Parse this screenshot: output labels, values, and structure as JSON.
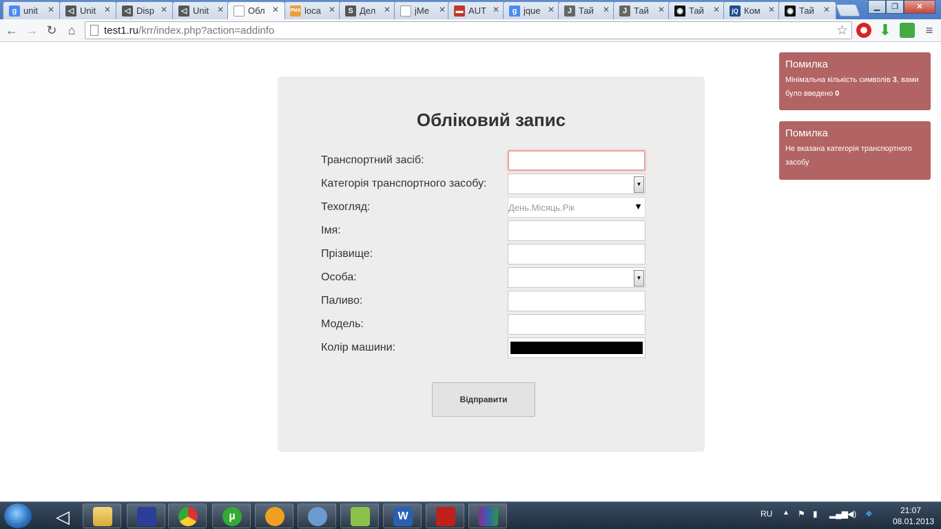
{
  "browser": {
    "tabs": [
      {
        "title": "unit",
        "fav": "g",
        "color": "#4a8af4"
      },
      {
        "title": "Unit",
        "fav": "◁",
        "color": "#555555"
      },
      {
        "title": "Disp",
        "fav": "◁",
        "color": "#555555"
      },
      {
        "title": "Unit",
        "fav": "◁",
        "color": "#555555"
      },
      {
        "title": "Обл",
        "fav": "",
        "color": "#ffffff",
        "active": true
      },
      {
        "title": "loca",
        "fav": "PMA",
        "color": "#e8a23a"
      },
      {
        "title": "Дел",
        "fav": "S",
        "color": "#555555"
      },
      {
        "title": "jMe",
        "fav": "",
        "color": "#ffffff"
      },
      {
        "title": "AUT",
        "fav": "▬",
        "color": "#c0392b"
      },
      {
        "title": "jque",
        "fav": "g",
        "color": "#4a8af4"
      },
      {
        "title": "Тай",
        "fav": "J",
        "color": "#666666"
      },
      {
        "title": "Тай",
        "fav": "J",
        "color": "#666666"
      },
      {
        "title": "Тай",
        "fav": "◉",
        "color": "#111111"
      },
      {
        "title": "Ком",
        "fav": "jQ",
        "color": "#1f4e8c"
      },
      {
        "title": "Тай",
        "fav": "◉",
        "color": "#111111"
      }
    ],
    "url_host": "test1.ru",
    "url_path": "/krr/index.php?action=addinfo"
  },
  "form": {
    "title": "Обліковий запис",
    "fields": [
      {
        "label": "Транспортний засіб:"
      },
      {
        "label": "Категорія транспортного засобу:"
      },
      {
        "label": "Техогляд:",
        "placeholder": "День.Місяць.Рік"
      },
      {
        "label": "Імя:"
      },
      {
        "label": "Прізвище:"
      },
      {
        "label": "Особа:"
      },
      {
        "label": "Паливо:"
      },
      {
        "label": "Модель:"
      },
      {
        "label": "Колір машини:",
        "value": "#000000"
      }
    ],
    "submit_label": "Відправити"
  },
  "notifications": [
    {
      "title": "Помилка",
      "text_before": "Мінімальна кількість символів ",
      "bold1": "3",
      "text_mid": ", вами було введено ",
      "bold2": "0"
    },
    {
      "title": "Помилка",
      "text": "Не вказана категорія транспортного засобу"
    }
  ],
  "taskbar": {
    "lang": "RU",
    "time": "21:07",
    "date": "08.01.2013"
  }
}
